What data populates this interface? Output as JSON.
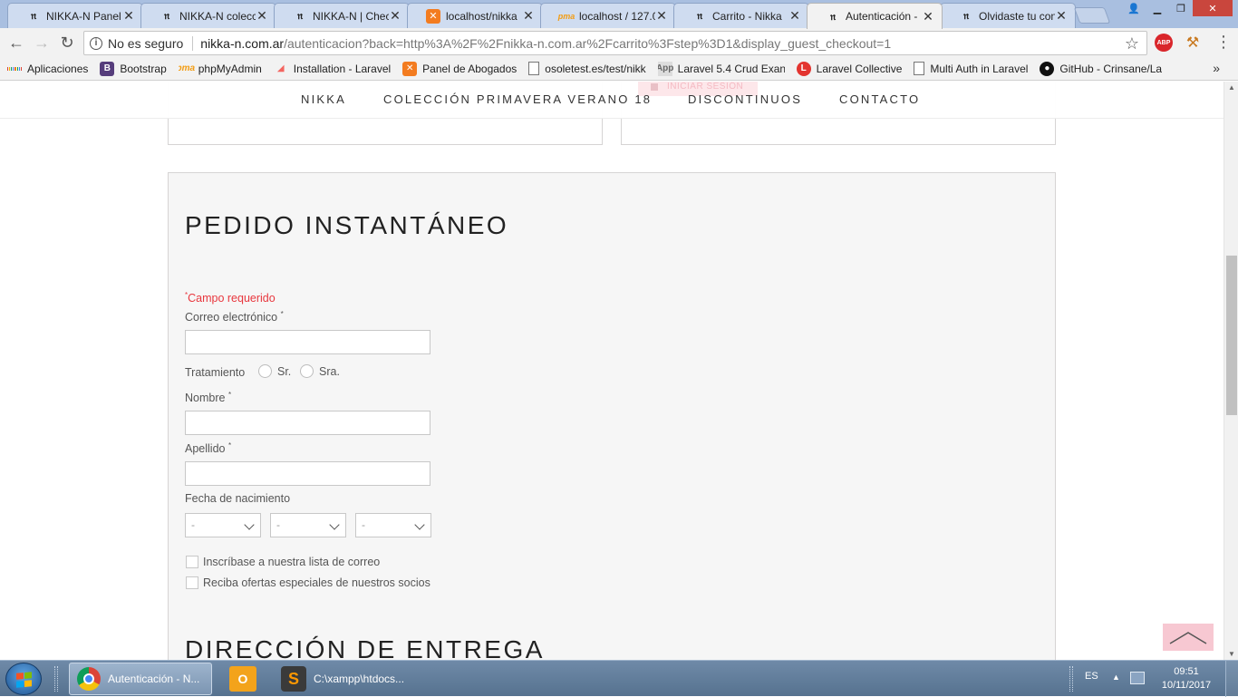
{
  "browser": {
    "tabs": [
      {
        "title": "NIKKA-N Panel d",
        "icon": "nikka-logo-icon",
        "active": false
      },
      {
        "title": "NIKKA-N colecc",
        "icon": "nikka-logo-icon",
        "active": false
      },
      {
        "title": "NIKKA-N | Chec",
        "icon": "nikka-logo-icon",
        "active": false
      },
      {
        "title": "localhost/nikka",
        "icon": "xampp-icon",
        "active": false
      },
      {
        "title": "localhost / 127.0",
        "icon": "phpmyadmin-icon",
        "active": false
      },
      {
        "title": "Carrito - Nikka",
        "icon": "nikka-logo-icon",
        "active": false
      },
      {
        "title": "Autenticación -",
        "icon": "nikka-logo-icon",
        "active": true
      },
      {
        "title": "Olvidaste tu con",
        "icon": "nikka-logo-icon",
        "active": false
      }
    ],
    "security_label": "No es seguro",
    "url_host": "nikka-n.com.ar",
    "url_rest": "/autenticacion?back=http%3A%2F%2Fnikka-n.com.ar%2Fcarrito%3Fstep%3D1&display_guest_checkout=1",
    "extensions": {
      "abp": "ABP"
    },
    "bookmarks": [
      {
        "label": "Aplicaciones",
        "icon": "apps-grid-icon"
      },
      {
        "label": "Bootstrap",
        "icon": "bootstrap-icon",
        "glyph": "B"
      },
      {
        "label": "phpMyAdmin",
        "icon": "phpmyadmin-icon",
        "glyph": "pma"
      },
      {
        "label": "Installation - Laravel",
        "icon": "laravel-icon",
        "glyph": "◢"
      },
      {
        "label": "Panel de Abogados",
        "icon": "xampp-icon",
        "glyph": "✕"
      },
      {
        "label": "osoletest.es/test/nikk",
        "icon": "page-icon",
        "glyph": ""
      },
      {
        "label": "Laravel 5.4 Crud Exan",
        "icon": "appdev-icon",
        "glyph": "App"
      },
      {
        "label": "Laravel Collective",
        "icon": "laravel-collective-icon",
        "glyph": "L"
      },
      {
        "label": "Multi Auth in Laravel",
        "icon": "page-icon",
        "glyph": ""
      },
      {
        "label": "GitHub - Crinsane/La",
        "icon": "github-icon",
        "glyph": "●"
      }
    ],
    "bookmarks_more": "»"
  },
  "site": {
    "ghost_button": "INICIAR SESIÓN",
    "nav": [
      "NIKKA",
      "COLECCIÓN PRIMAVERA VERANO 18",
      "DISCONTINUOS",
      "CONTACTO"
    ]
  },
  "form": {
    "title": "PEDIDO INSTANTÁNEO",
    "required_mark": "*",
    "required_note": "Campo requerido",
    "email_label": "Correo electrónico",
    "email_value": "",
    "title_label": "Tratamiento",
    "title_options": [
      "Sr.",
      "Sra."
    ],
    "firstname_label": "Nombre",
    "firstname_value": "",
    "lastname_label": "Apellido",
    "lastname_value": "",
    "birthdate_label": "Fecha de nacimiento",
    "birthdate_day": "-",
    "birthdate_month": "-",
    "birthdate_year": "-",
    "newsletter_label": "Inscríbase a nuestra lista de correo",
    "optin_label": "Reciba ofertas especiales de nuestros socios",
    "address_title": "DIRECCIÓN DE ENTREGA"
  },
  "taskbar": {
    "items": [
      {
        "label": "Autenticación - N...",
        "icon": "chrome-icon",
        "active": true
      },
      {
        "label": "",
        "icon": "outlook-icon",
        "glyph": "O"
      },
      {
        "label": "C:\\xampp\\htdocs...",
        "icon": "sublime-text-icon",
        "glyph": "S"
      }
    ],
    "lang": "ES",
    "time": "09:51",
    "date": "10/11/2017"
  },
  "colors": {
    "accent_pink": "#f7c8d2",
    "required_red": "#e8373e",
    "panel_bg": "#f6f6f6"
  }
}
